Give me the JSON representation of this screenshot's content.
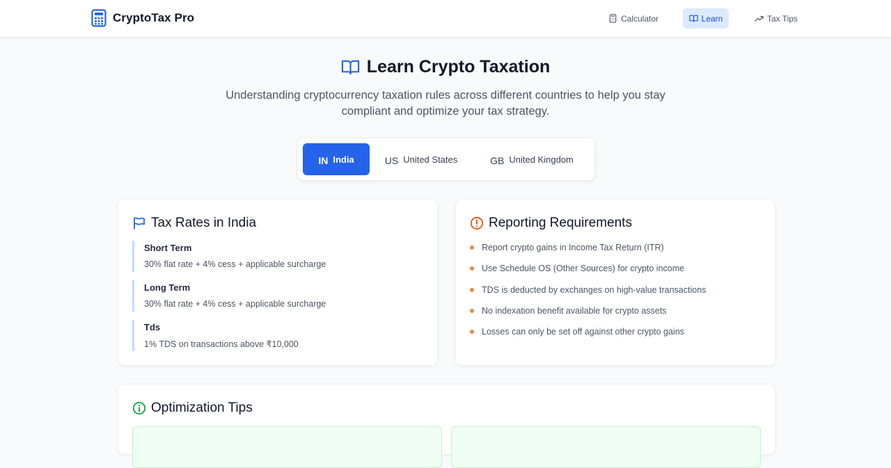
{
  "header": {
    "brand": "CryptoTax Pro",
    "nav": [
      {
        "label": "Calculator",
        "icon": "calculator-icon"
      },
      {
        "label": "Learn",
        "icon": "book-icon",
        "active": true
      },
      {
        "label": "Tax Tips",
        "icon": "trending-up-icon"
      }
    ]
  },
  "hero": {
    "title": "Learn Crypto Taxation",
    "subtitle": "Understanding cryptocurrency taxation rules across different countries to help you stay compliant and optimize your tax strategy."
  },
  "tabs": [
    {
      "code": "IN",
      "label": "India",
      "active": true
    },
    {
      "code": "US",
      "label": "United States"
    },
    {
      "code": "GB",
      "label": "United Kingdom"
    }
  ],
  "rates_card": {
    "title": "Tax Rates in India",
    "icon": "flag-icon",
    "items": [
      {
        "name": "Short Term",
        "desc": "30% flat rate + 4% cess + applicable surcharge"
      },
      {
        "name": "Long Term",
        "desc": "30% flat rate + 4% cess + applicable surcharge"
      },
      {
        "name": "Tds",
        "desc": "1% TDS on transactions above ₹10,000"
      }
    ]
  },
  "report_card": {
    "title": "Reporting Requirements",
    "icon": "alert-circle-icon",
    "items": [
      "Report crypto gains in Income Tax Return (ITR)",
      "Use Schedule OS (Other Sources) for crypto income",
      "TDS is deducted by exchanges on high-value transactions",
      "No indexation benefit available for crypto assets",
      "Losses can only be set off against other crypto gains"
    ]
  },
  "tips_card": {
    "title": "Optimization Tips",
    "icon": "info-icon"
  },
  "colors": {
    "accent": "#2563eb",
    "nav_active_bg": "#dbeafe",
    "bullet": "#f0883e",
    "rate_border": "#bfdbfe",
    "tip_green": "#16a34a"
  }
}
